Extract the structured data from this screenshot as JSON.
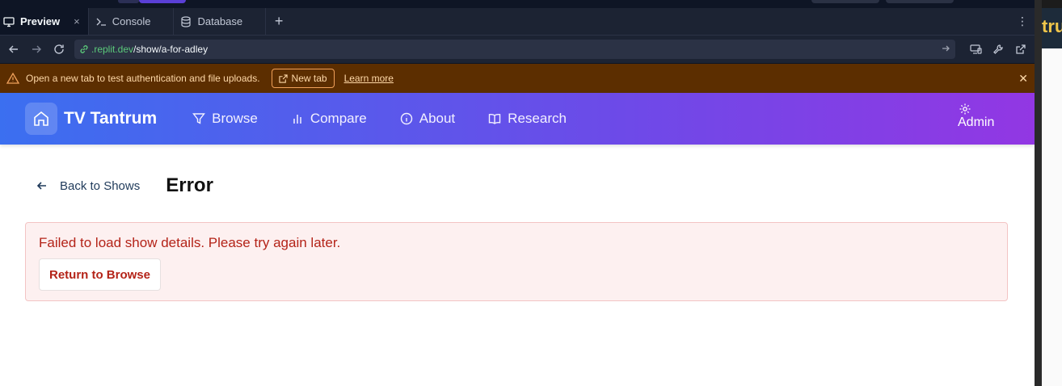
{
  "tabs": [
    {
      "label": "Preview",
      "icon": "monitor-icon",
      "active": true,
      "close": "×"
    },
    {
      "label": "Console",
      "icon": "terminal-icon"
    },
    {
      "label": "Database",
      "icon": "database-icon"
    }
  ],
  "tab_add": "+",
  "tab_menu": "⋮",
  "url": {
    "host": ".replit.dev",
    "path": "/show/a-for-adley"
  },
  "banner": {
    "message": "Open a new tab to test authentication and file uploads.",
    "new_tab": "New tab",
    "learn_more": "Learn more",
    "close": "✕"
  },
  "app": {
    "brand": "TV Tantrum",
    "nav": [
      {
        "label": "Browse",
        "icon": "filter-icon"
      },
      {
        "label": "Compare",
        "icon": "bar-chart-icon"
      },
      {
        "label": "About",
        "icon": "info-icon"
      },
      {
        "label": "Research",
        "icon": "book-icon"
      }
    ],
    "admin": "Admin",
    "back": "Back to Shows",
    "title": "Error",
    "error_message": "Failed to load show details. Please try again later.",
    "return_button": "Return to Browse"
  },
  "edge_peek": "tru",
  "colors": {
    "nav_start": "#3b6ff0",
    "nav_end": "#9237e3",
    "error_text": "#b42318",
    "banner_bg": "#5c2e00"
  }
}
